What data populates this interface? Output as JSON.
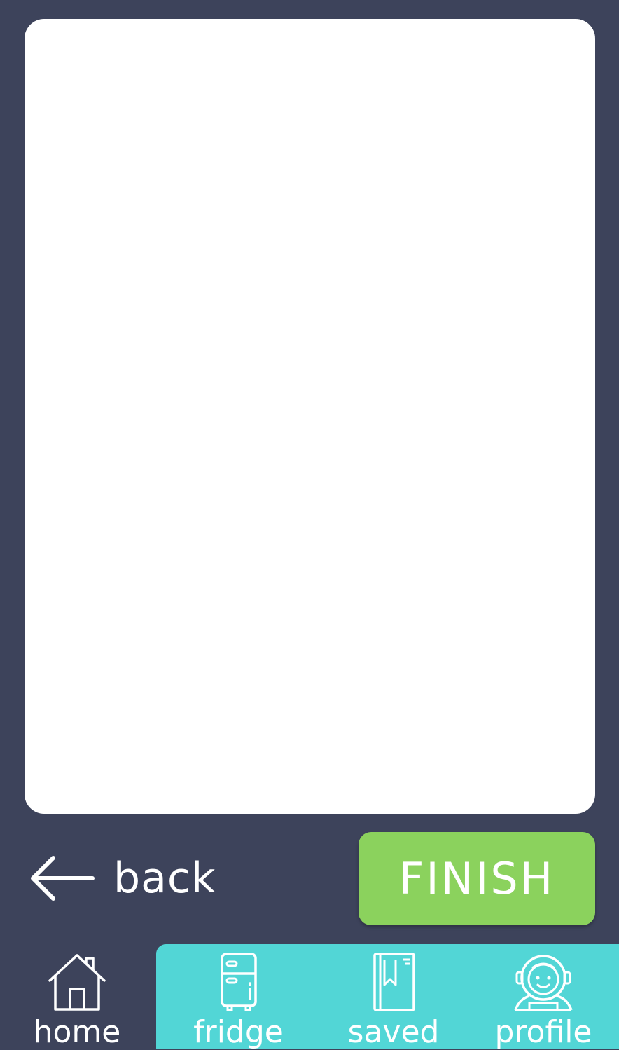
{
  "back": {
    "label": "back",
    "icon": "arrow-left-icon"
  },
  "finish": {
    "label": "FINISH",
    "color": "#8bd25d"
  },
  "nav": {
    "active_color": "#52d6d6",
    "background_color": "#3d435b",
    "items": [
      {
        "label": "home",
        "icon": "home-icon",
        "active": true
      },
      {
        "label": "fridge",
        "icon": "fridge-icon",
        "active": false
      },
      {
        "label": "saved",
        "icon": "book-bookmark-icon",
        "active": false
      },
      {
        "label": "profile",
        "icon": "astronaut-icon",
        "active": false
      }
    ]
  }
}
